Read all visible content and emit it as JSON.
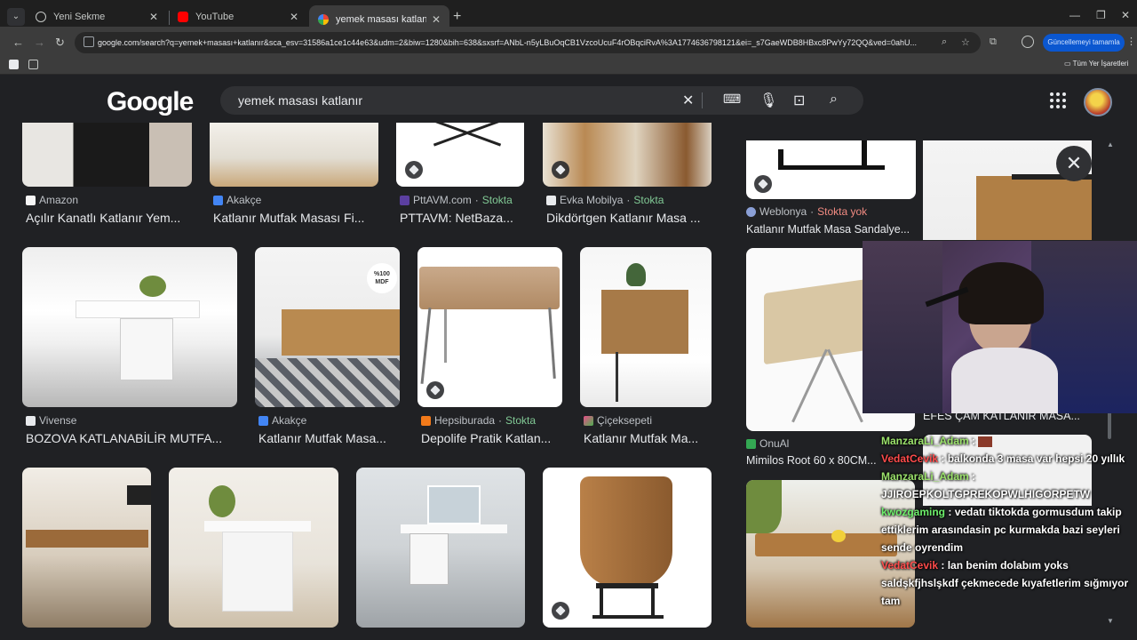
{
  "browser": {
    "tabs": [
      {
        "title": "Yeni Sekme"
      },
      {
        "title": "YouTube"
      },
      {
        "title": "yemek masası katlanır - Google"
      }
    ],
    "url": "google.com/search?q=yemek+masası+katlanır&sca_esv=31586a1ce1c44e63&udm=2&biw=1280&bih=638&sxsrf=ANbL-n5yLBuOqCB1VzcoUcuF4rOBqciRvA%3A1774636798121&ei=_s7GaeWDB8HBxc8PwYy72QQ&ved=0ahU...",
    "update_button": "Güncellemeyi tamamla",
    "bookmarks_all": "Tüm Yer İşaretleri"
  },
  "search": {
    "logo": "Google",
    "query": "yemek masası katlanır"
  },
  "results": [
    {
      "source": "Amazon",
      "title": "Açılır Kanatlı Katlanır Yem..."
    },
    {
      "source": "Akakçe",
      "title": "Katlanır Mutfak Masası Fi..."
    },
    {
      "source": "PttAVM.com",
      "stock": "Stokta",
      "title": "PTTAVM: NetBaza..."
    },
    {
      "source": "Evka Mobilya",
      "stock": "Stokta",
      "title": "Dikdörtgen Katlanır Masa ..."
    },
    {
      "source": "Vivense",
      "title": "BOZOVA KATLANABİLİR MUTFA..."
    },
    {
      "source": "Akakçe",
      "title": "Katlanır Mutfak Masa..."
    },
    {
      "source": "Hepsiburada",
      "stock": "Stokta",
      "title": "Depolife Pratik Katlan..."
    },
    {
      "source": "Çiçeksepeti",
      "title": "Katlanır Mutfak Ma..."
    }
  ],
  "side_results": [
    {
      "source": "Weblonya",
      "stock": "Stokta yok",
      "title": "Katlanır Mutfak Masa Sandalye..."
    },
    {
      "source": "OnuAl",
      "title": "Mimilos Root 60 x 80CM..."
    },
    {
      "title": "EFES ÇAM KATLANIR MASA..."
    }
  ],
  "mdf_badge": "%100 MDF",
  "chat": [
    {
      "user": "ManzaraLi_Adam",
      "text": ""
    },
    {
      "user": "VedatCevik",
      "text": "balkonda 3 masa var hepsi 20 yıllık"
    },
    {
      "user": "ManzaraLi_Adam",
      "text": "JJIROEPKOLTGPREKOPWLHIGORPETW"
    },
    {
      "user": "kwozgaming",
      "text": "vedatı tiktokda gormusdum takip ettiklerim arasındasin pc kurmakda bazi seyleri sende oyrendim"
    },
    {
      "user": "VedatCevik",
      "text": "lan benim dolabım yoks saldşkfjhslşkdf çekmecede kıyafetlerim sığmıyor tam"
    }
  ]
}
